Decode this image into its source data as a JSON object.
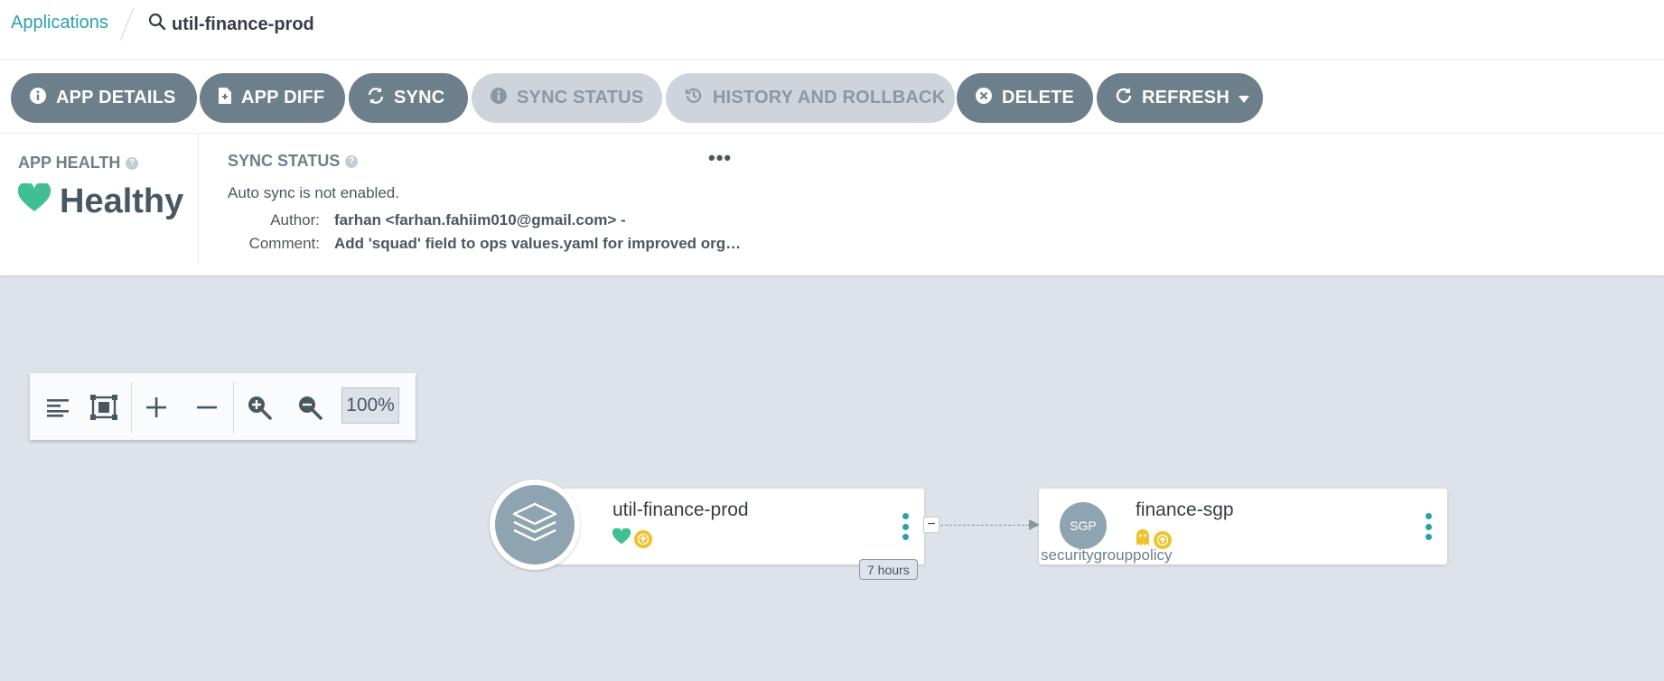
{
  "breadcrumb": {
    "applications": "Applications",
    "app_name": "util-finance-prod"
  },
  "toolbar": {
    "app_details": "APP DETAILS",
    "app_diff": "APP DIFF",
    "sync": "SYNC",
    "sync_status": "SYNC STATUS",
    "history": "HISTORY AND ROLLBACK",
    "delete": "DELETE",
    "refresh": "REFRESH"
  },
  "health": {
    "label": "APP HEALTH",
    "status": "Healthy",
    "color": "#18be94"
  },
  "sync": {
    "label": "SYNC STATUS",
    "message": "Auto sync is not enabled.",
    "author_label": "Author:",
    "author_value": "farhan <farhan.fahiim010@gmail.com> -",
    "comment_label": "Comment:",
    "comment_value": "Add 'squad' field to ops values.yaml for improved org…"
  },
  "zoom": {
    "level": "100%"
  },
  "graph": {
    "app_node": {
      "name": "util-finance-prod",
      "age": "7 hours",
      "health_icon": "heart-icon",
      "sync_icon": "out-of-sync-icon"
    },
    "resource_node": {
      "name": "finance-sgp",
      "abbrev": "SGP",
      "kind": "securitygrouppolicy",
      "health_icon": "ghost-icon",
      "sync_icon": "out-of-sync-icon"
    }
  },
  "colors": {
    "accent": "#2a9fb0",
    "button": "#6d7f8b",
    "warning": "#f2c12e",
    "canvas": "#dee2e9"
  }
}
